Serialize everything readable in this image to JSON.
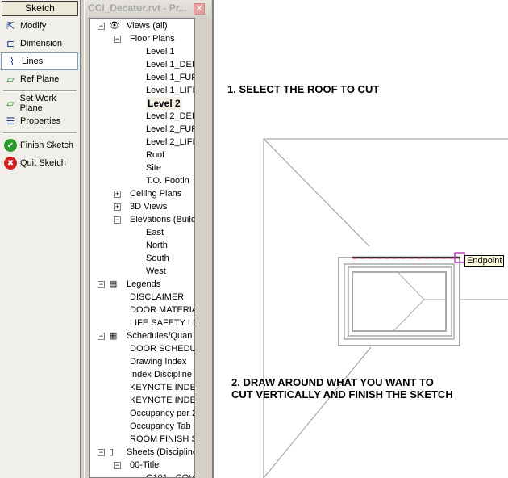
{
  "palette": {
    "header": "Sketch",
    "items": [
      {
        "label": "Modify",
        "icon": "cursor-icon"
      },
      {
        "label": "Dimension",
        "icon": "dimension-icon"
      },
      {
        "label": "Lines",
        "icon": "lines-icon",
        "selected": true
      },
      {
        "label": "Ref Plane",
        "icon": "ref-plane-icon"
      },
      {
        "label": "Set Work Plane",
        "icon": "work-plane-icon"
      },
      {
        "label": "Properties",
        "icon": "properties-icon"
      },
      {
        "label": "Finish Sketch",
        "icon": "check-icon"
      },
      {
        "label": "Quit Sketch",
        "icon": "x-icon"
      }
    ]
  },
  "browser": {
    "title": "CCI_Decatur.rvt - Pr...",
    "tree": [
      {
        "l": 0,
        "t": "Views (all)",
        "e": "-",
        "icon": "eye"
      },
      {
        "l": 1,
        "t": "Floor Plans",
        "e": "-"
      },
      {
        "l": 2,
        "t": "Level 1"
      },
      {
        "l": 2,
        "t": "Level 1_DEI"
      },
      {
        "l": 2,
        "t": "Level 1_FUF"
      },
      {
        "l": 2,
        "t": "Level 1_LIFI"
      },
      {
        "l": 2,
        "t": "Level 2",
        "bold": true
      },
      {
        "l": 2,
        "t": "Level 2_DEI"
      },
      {
        "l": 2,
        "t": "Level 2_FUF"
      },
      {
        "l": 2,
        "t": "Level 2_LIFI"
      },
      {
        "l": 2,
        "t": "Roof"
      },
      {
        "l": 2,
        "t": "Site"
      },
      {
        "l": 2,
        "t": "T.O. Footin"
      },
      {
        "l": 1,
        "t": "Ceiling Plans",
        "e": "+"
      },
      {
        "l": 1,
        "t": "3D Views",
        "e": "+"
      },
      {
        "l": 1,
        "t": "Elevations (Build",
        "e": "-"
      },
      {
        "l": 2,
        "t": "East"
      },
      {
        "l": 2,
        "t": "North"
      },
      {
        "l": 2,
        "t": "South"
      },
      {
        "l": 2,
        "t": "West"
      },
      {
        "l": 0,
        "t": "Legends",
        "e": "-",
        "icon": "legend"
      },
      {
        "l": 1,
        "t": "DISCLAIMER"
      },
      {
        "l": 1,
        "t": "DOOR MATERIA"
      },
      {
        "l": 1,
        "t": "LIFE SAFETY LE"
      },
      {
        "l": 0,
        "t": "Schedules/Quan",
        "e": "-",
        "icon": "table"
      },
      {
        "l": 1,
        "t": "DOOR SCHEDU"
      },
      {
        "l": 1,
        "t": "Drawing Index"
      },
      {
        "l": 1,
        "t": "Index Discipline"
      },
      {
        "l": 1,
        "t": "KEYNOTE INDE"
      },
      {
        "l": 1,
        "t": "KEYNOTE INDE"
      },
      {
        "l": 1,
        "t": "Occupancy per 2"
      },
      {
        "l": 1,
        "t": "Occupancy Tab"
      },
      {
        "l": 1,
        "t": "ROOM FINISH S"
      },
      {
        "l": 0,
        "t": "Sheets (Discipline",
        "e": "-",
        "icon": "sheet"
      },
      {
        "l": 1,
        "t": "00-Title",
        "e": "-"
      },
      {
        "l": 2,
        "t": "G101 - COV"
      }
    ]
  },
  "canvas": {
    "note1": "1. SELECT THE ROOF TO CUT",
    "note2_line1": "2. DRAW AROUND WHAT YOU WANT TO",
    "note2_line2": "CUT VERTICALLY AND FINISH THE SKETCH",
    "tooltip": "Endpoint"
  }
}
